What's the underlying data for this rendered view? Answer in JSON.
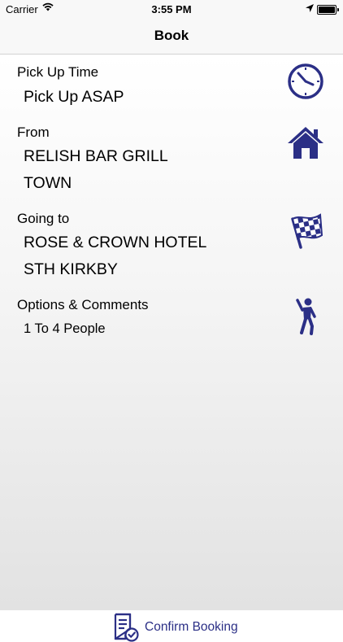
{
  "status_bar": {
    "carrier": "Carrier",
    "time": "3:55 PM",
    "battery_level": 1.0
  },
  "nav": {
    "title": "Book"
  },
  "sections": {
    "pickup": {
      "label": "Pick Up Time",
      "value": "Pick Up ASAP",
      "icon": "clock-icon"
    },
    "from": {
      "label": "From",
      "line1": "RELISH BAR GRILL",
      "line2": "TOWN",
      "icon": "house-icon"
    },
    "going_to": {
      "label": "Going to",
      "line1": "ROSE & CROWN HOTEL",
      "line2": "STH KIRKBY",
      "icon": "checkered-flag-icon"
    },
    "options": {
      "label": "Options & Comments",
      "value": "1 To 4 People",
      "icon": "person-icon"
    }
  },
  "confirm": {
    "label": "Confirm Booking",
    "icon": "document-check-icon"
  },
  "colors": {
    "icon_blue": "#2b2f86",
    "nav_bg": "#f8f8f8"
  }
}
